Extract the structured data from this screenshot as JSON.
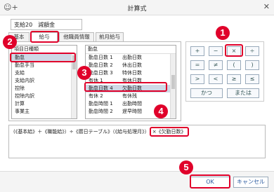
{
  "window": {
    "title": "計算式",
    "app_icon": "people-plus-icon",
    "close_glyph": "✕"
  },
  "name_field": {
    "value": "支給20　減額金"
  },
  "tabs": [
    "基本",
    "給与",
    "他職員情報",
    "前月給与"
  ],
  "category_list": {
    "header": "項目日種類",
    "items": [
      "勤怠",
      "勤怠手当",
      "支給",
      "支給内訳",
      "控除",
      "控除内訳",
      "計算",
      "事業主"
    ],
    "selected": "勤怠"
  },
  "item_list": {
    "header": "勤怠",
    "rows": [
      {
        "code": "勤怠日数 1",
        "name": "出勤日数"
      },
      {
        "code": "勤怠日数 2",
        "name": "休出日数"
      },
      {
        "code": "勤怠日数 3",
        "name": "特休日数"
      },
      {
        "code": "有休 1",
        "name": "有休日数"
      },
      {
        "code": "勤怠日数 4",
        "name": "欠勤日数"
      },
      {
        "code": "有休 2",
        "name": "有休残"
      },
      {
        "code": "勤怠時間 1",
        "name": "出勤時間"
      },
      {
        "code": "勤怠時間 2",
        "name": "遅早時間"
      }
    ],
    "selected": "勤怠日数 4"
  },
  "operators": {
    "row1": [
      "+",
      "−",
      "×",
      "÷"
    ],
    "row2": [
      "=",
      "≠",
      "(",
      ")"
    ],
    "row3": [
      ">",
      "<",
      "≥",
      "≤"
    ],
    "and_label": "かつ",
    "or_label": "または"
  },
  "formula": {
    "text": "(《基本給》＋《職能給》）÷《暦日テーブル》（《給与処理月》）",
    "appended": "×《欠勤日数》"
  },
  "buttons": {
    "ok": "OK",
    "cancel": "キャンセル"
  },
  "markers": [
    "1",
    "2",
    "3",
    "4",
    "5"
  ],
  "colors": {
    "highlight": "#e0002a"
  }
}
